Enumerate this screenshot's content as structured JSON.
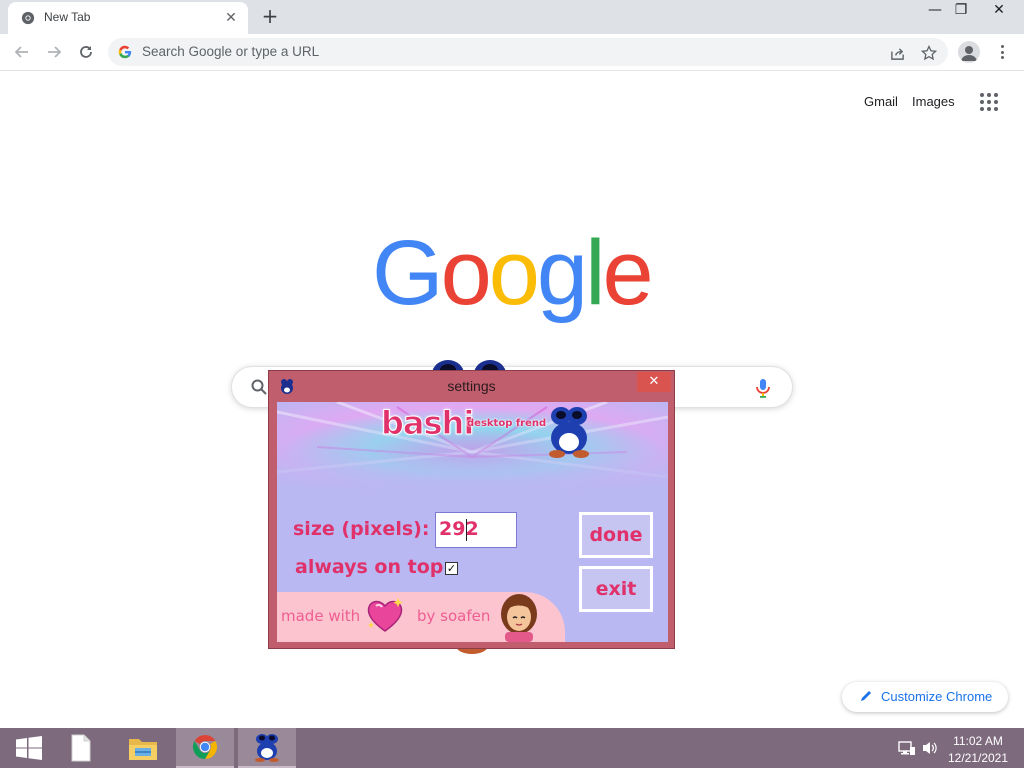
{
  "browser": {
    "tab": {
      "title": "New Tab",
      "close_glyph": "✕",
      "favicon": "chrome-icon"
    },
    "newtab_glyph": "+",
    "window_controls": {
      "minimize": "—",
      "restore": "❐",
      "close": "✕"
    },
    "omnibox": {
      "placeholder": "Search Google or type a URL"
    }
  },
  "ntp": {
    "links": {
      "gmail": "Gmail",
      "images": "Images"
    },
    "logo_letters": [
      "G",
      "o",
      "o",
      "g",
      "l",
      "e"
    ],
    "logo_colors": [
      "#4285F4",
      "#EA4335",
      "#FBBC05",
      "#4285F4",
      "#34A853",
      "#EA4335"
    ],
    "customize_label": "Customize Chrome"
  },
  "dialog": {
    "title": "settings",
    "close_glyph": "✕",
    "banner": {
      "title": "bashi",
      "subtitle": "desktop frend"
    },
    "size_label": "size (pixels):",
    "size_value": "292",
    "always_on_top_label": "always on top",
    "always_on_top_checked": true,
    "checkmark": "✓",
    "done_label": "done",
    "exit_label": "exit",
    "credit_made_with": "made with",
    "credit_by": "by soafen",
    "colors": {
      "accent": "#e0316a",
      "frame": "#c15e6e",
      "client_bg": "#b9b8f2"
    }
  },
  "taskbar": {
    "apps": [
      "windows-start-icon",
      "file-icon",
      "file-explorer-icon",
      "chrome-icon",
      "bashi-icon"
    ],
    "active_apps": [
      "chrome-icon",
      "bashi-icon"
    ],
    "clock": {
      "time": "11:02 AM",
      "date": "12/21/2021"
    }
  }
}
